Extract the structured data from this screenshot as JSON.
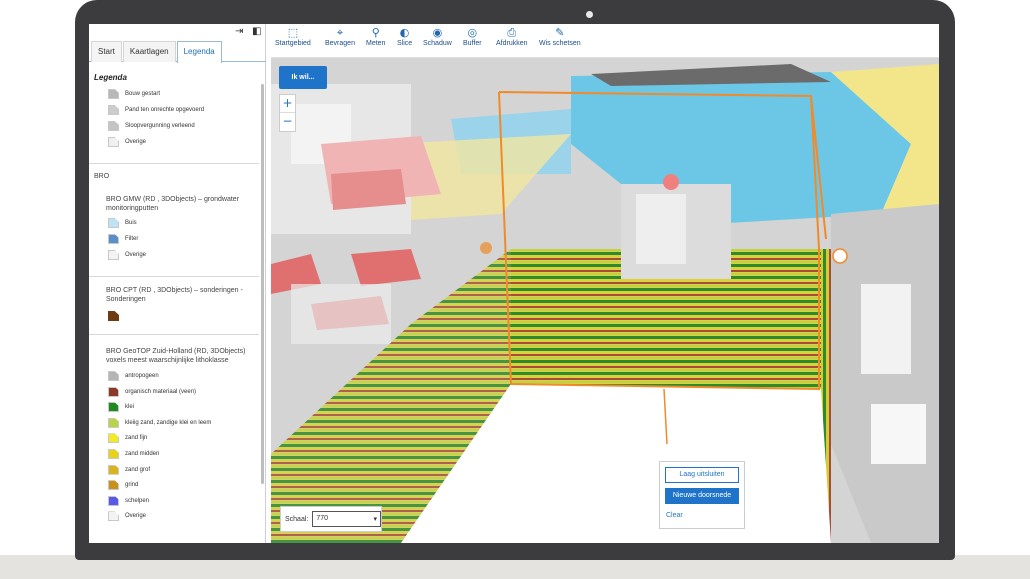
{
  "sidebar": {
    "tabs": [
      {
        "label": "Start"
      },
      {
        "label": "Kaartlagen"
      },
      {
        "label": "Legenda"
      }
    ],
    "legend_title": "Legenda",
    "group1_items": [
      {
        "label": "Bouw gestart",
        "color": "#b8b8b8"
      },
      {
        "label": "Pand ten onrechte opgevoerd",
        "color": "#cccccc"
      },
      {
        "label": "Sloopvergunning verleend",
        "color": "#c4c4c4"
      },
      {
        "label": "Overige",
        "color": "#f0f0f0"
      }
    ],
    "bro_label": "BRO",
    "gmw_title": "BRO GMW (RD , 3DObjects) – grondwater monitoringputten",
    "gmw_items": [
      {
        "label": "Buis",
        "color": "#bfe3f5"
      },
      {
        "label": "Filter",
        "color": "#5b8ec7"
      },
      {
        "label": "Overige",
        "color": "#f3f3f3"
      }
    ],
    "cpt_title": "BRO CPT (RD , 3DObjects) – sonderingen - Sonderingen",
    "cpt_color": "#6e3a12",
    "geotop_title": "BRO GeoTOP Zuid-Holland (RD, 3DObjects) voxels meest waarschijnlijke lithoklasse",
    "geotop_items": [
      {
        "label": "antropogeen",
        "color": "#b5b5b5"
      },
      {
        "label": "organisch materiaal (veen)",
        "color": "#8b3a2a"
      },
      {
        "label": "klei",
        "color": "#1f8a1f"
      },
      {
        "label": "kleiig zand, zandige klei en leem",
        "color": "#b8d24a"
      },
      {
        "label": "zand fijn",
        "color": "#f0ea2a"
      },
      {
        "label": "zand midden",
        "color": "#e8d21a"
      },
      {
        "label": "zand grof",
        "color": "#d9b320"
      },
      {
        "label": "grind",
        "color": "#c8921a"
      },
      {
        "label": "schelpen",
        "color": "#5a5ae6"
      },
      {
        "label": "Overige",
        "color": "#f3f3f3"
      }
    ]
  },
  "toolbar": [
    {
      "label": "Startgebied",
      "icon": "start-area-icon"
    },
    {
      "label": "Bevragen",
      "icon": "query-icon"
    },
    {
      "label": "Meten",
      "icon": "measure-icon"
    },
    {
      "label": "Slice",
      "icon": "slice-icon"
    },
    {
      "label": "Schaduw",
      "icon": "shadow-icon"
    },
    {
      "label": "Buffer",
      "icon": "buffer-icon"
    },
    {
      "label": "Afdrukken",
      "icon": "print-icon"
    },
    {
      "label": "Wis schetsen",
      "icon": "clear-sketch-icon"
    }
  ],
  "map": {
    "ikwil_label": "Ik wil...",
    "zoom_in": "+",
    "zoom_out": "−",
    "scale_label": "Schaal:",
    "scale_value": "770",
    "section_buttons": {
      "hide_layer": "Laag uitsluiten",
      "new_section": "Nieuwe doorsnede",
      "clear": "Clear"
    }
  },
  "colors": {
    "accent": "#1f74c9",
    "bezel": "#3c3c3e"
  }
}
